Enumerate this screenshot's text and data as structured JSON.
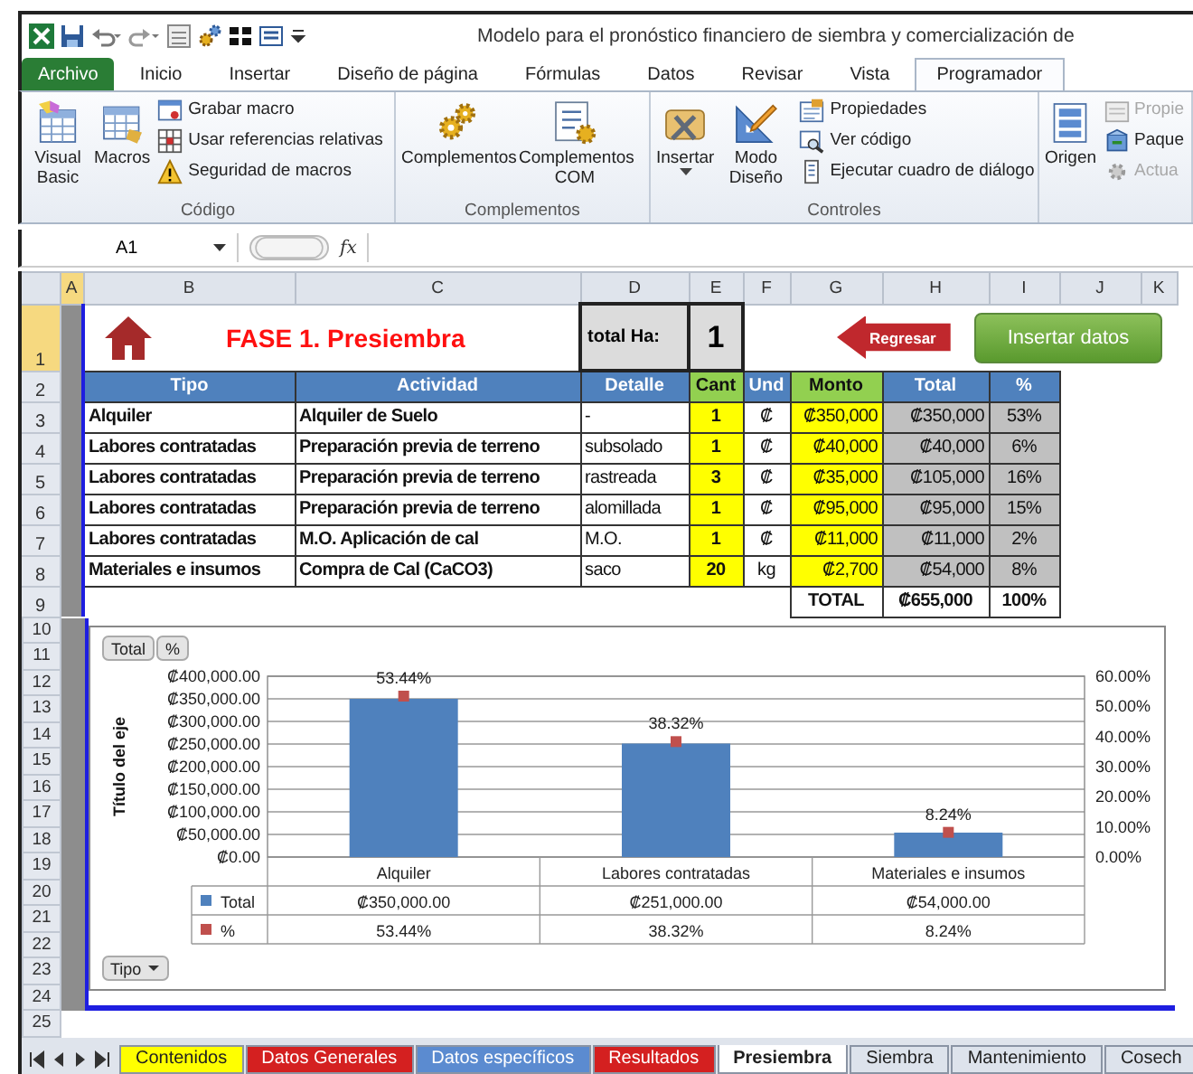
{
  "window": {
    "title": "Modelo para el pronóstico financiero de siembra y comercialización de"
  },
  "menu_tabs": [
    {
      "label": "Archivo",
      "kind": "file",
      "selected": false
    },
    {
      "label": "Inicio",
      "kind": "tab",
      "selected": false
    },
    {
      "label": "Insertar",
      "kind": "tab",
      "selected": false
    },
    {
      "label": "Diseño de página",
      "kind": "tab",
      "selected": false
    },
    {
      "label": "Fórmulas",
      "kind": "tab",
      "selected": false
    },
    {
      "label": "Datos",
      "kind": "tab",
      "selected": false
    },
    {
      "label": "Revisar",
      "kind": "tab",
      "selected": false
    },
    {
      "label": "Vista",
      "kind": "tab",
      "selected": false
    },
    {
      "label": "Programador",
      "kind": "tab",
      "selected": true
    }
  ],
  "ribbon": {
    "groups": [
      {
        "label": "Código",
        "large": [
          {
            "label": "Visual Basic",
            "dropdown": false
          },
          {
            "label": "Macros",
            "dropdown": false
          }
        ],
        "small": [
          {
            "label": "Grabar macro",
            "disabled": false
          },
          {
            "label": "Usar referencias relativas",
            "disabled": false
          },
          {
            "label": "Seguridad de macros",
            "disabled": false
          }
        ]
      },
      {
        "label": "Complementos",
        "large": [
          {
            "label": "Complementos",
            "dropdown": false
          },
          {
            "label": "Complementos COM",
            "dropdown": false
          }
        ]
      },
      {
        "label": "Controles",
        "large": [
          {
            "label": "Insertar",
            "dropdown": true
          },
          {
            "label": "Modo Diseño",
            "dropdown": false
          }
        ],
        "small": [
          {
            "label": "Propiedades",
            "disabled": false
          },
          {
            "label": "Ver código",
            "disabled": false
          },
          {
            "label": "Ejecutar cuadro de diálogo",
            "disabled": false
          }
        ]
      },
      {
        "large": [
          {
            "label": "Origen",
            "dropdown": false
          }
        ],
        "small": [
          {
            "label": "Propie",
            "disabled": true
          },
          {
            "label": "Paque",
            "disabled": false
          },
          {
            "label": "Actua",
            "disabled": true
          }
        ]
      }
    ]
  },
  "formula_bar": {
    "name_box": "A1",
    "function_label": "fx"
  },
  "column_headers": [
    {
      "label": "A",
      "selected": true
    },
    {
      "label": "B",
      "selected": false
    },
    {
      "label": "C",
      "selected": false
    },
    {
      "label": "D",
      "selected": false
    },
    {
      "label": "E",
      "selected": false
    },
    {
      "label": "F",
      "selected": false
    },
    {
      "label": "G",
      "selected": false
    },
    {
      "label": "H",
      "selected": false
    },
    {
      "label": "I",
      "selected": false
    },
    {
      "label": "J",
      "selected": false
    },
    {
      "label": "K",
      "selected": false
    }
  ],
  "row_numbers": [
    {
      "label": "1",
      "selected": true
    },
    {
      "label": "2",
      "selected": false
    },
    {
      "label": "3",
      "selected": false
    },
    {
      "label": "4",
      "selected": false
    },
    {
      "label": "5",
      "selected": false
    },
    {
      "label": "6",
      "selected": false
    },
    {
      "label": "7",
      "selected": false
    },
    {
      "label": "8",
      "selected": false
    },
    {
      "label": "9",
      "selected": false
    },
    {
      "label": "10",
      "selected": false
    },
    {
      "label": "11",
      "selected": false
    },
    {
      "label": "12",
      "selected": false
    },
    {
      "label": "13",
      "selected": false
    },
    {
      "label": "14",
      "selected": false
    },
    {
      "label": "15",
      "selected": false
    },
    {
      "label": "16",
      "selected": false
    },
    {
      "label": "17",
      "selected": false
    },
    {
      "label": "18",
      "selected": false
    },
    {
      "label": "19",
      "selected": false
    },
    {
      "label": "20",
      "selected": false
    },
    {
      "label": "21",
      "selected": false
    },
    {
      "label": "22",
      "selected": false
    },
    {
      "label": "23",
      "selected": false
    },
    {
      "label": "24",
      "selected": false
    },
    {
      "label": "25",
      "selected": false
    }
  ],
  "sheet": {
    "title": "FASE 1. Presiembra",
    "total_ha_label": "total Ha:",
    "total_ha": "1",
    "back_button": "Regresar",
    "insert_button": "Insertar datos",
    "headers": [
      {
        "label": "Tipo",
        "color": "#4f81bd"
      },
      {
        "label": "Actividad",
        "color": "#4f81bd"
      },
      {
        "label": "Detalle",
        "color": "#4f81bd"
      },
      {
        "label": "Cant",
        "color": "#92d050"
      },
      {
        "label": "Und",
        "color": "#4f81bd"
      },
      {
        "label": "Monto",
        "color": "#92d050"
      },
      {
        "label": "Total",
        "color": "#4f81bd"
      },
      {
        "label": "%",
        "color": "#4f81bd"
      }
    ],
    "rows": [
      [
        "Alquiler",
        "Alquiler de Suelo",
        "-",
        "1",
        "₡",
        "₡350,000",
        "₡350,000",
        "53%"
      ],
      [
        "Labores contratadas",
        "Preparación previa de terreno",
        "subsolado",
        "1",
        "₡",
        "₡40,000",
        "₡40,000",
        "6%"
      ],
      [
        "Labores contratadas",
        "Preparación previa de terreno",
        "rastreada",
        "3",
        "₡",
        "₡35,000",
        "₡105,000",
        "16%"
      ],
      [
        "Labores contratadas",
        "Preparación previa de terreno",
        "alomillada",
        "1",
        "₡",
        "₡95,000",
        "₡95,000",
        "15%"
      ],
      [
        "Labores contratadas",
        "M.O. Aplicación de cal",
        "M.O.",
        "1",
        "₡",
        "₡11,000",
        "₡11,000",
        "2%"
      ],
      [
        "Materiales e insumos",
        "Compra de Cal (CaCO3)",
        "saco",
        "20",
        "kg",
        "₡2,700",
        "₡54,000",
        "8%"
      ]
    ],
    "total_row": {
      "label": "TOTAL",
      "total": "₡655,000",
      "percent": "100%"
    }
  },
  "chart": {
    "pivot_buttons": [
      {
        "label": "Total"
      },
      {
        "label": "%"
      }
    ],
    "axis_field_button": "Tipo",
    "chart_data": {
      "type": "bar",
      "ylabel": "Título del eje",
      "categories": [
        "Alquiler",
        "Labores contratadas",
        "Materiales e insumos"
      ],
      "series": [
        {
          "name": "Total",
          "color": "#4f81bd",
          "values": [
            350000,
            251000,
            54000
          ]
        },
        {
          "name": "%",
          "color": "#c0504d",
          "values": [
            53.4,
            38.3,
            8.2
          ]
        }
      ],
      "grid": true,
      "ylim": [
        0,
        400000
      ],
      "yticks": [
        {
          "value": 0,
          "label": "₡0.00"
        },
        {
          "value": 50000,
          "label": "₡50,000.00"
        },
        {
          "value": 100000,
          "label": "₡100,000.00"
        },
        {
          "value": 150000,
          "label": "₡150,000.00"
        },
        {
          "value": 200000,
          "label": "₡200,000.00"
        },
        {
          "value": 250000,
          "label": "₡250,000.00"
        },
        {
          "value": 300000,
          "label": "₡300,000.00"
        },
        {
          "value": 350000,
          "label": "₡350,000.00"
        },
        {
          "value": 400000,
          "label": "₡400,000.00"
        }
      ],
      "value_labels": [
        "53.44%",
        "38.32%",
        "8.24%"
      ]
    },
    "secondary_axis": {
      "ticks": [
        "60.00%",
        "50.00%",
        "40.00%",
        "30.00%",
        "20.00%",
        "10.00%",
        "0.00%"
      ]
    },
    "data_table": [
      {
        "cells": [
          "₡350,000.00",
          "₡251,000.00",
          "₡54,000.00"
        ]
      },
      {
        "cells": [
          "53.44%",
          "38.32%",
          "8.24%"
        ]
      }
    ]
  },
  "sheet_tabs": [
    {
      "label": "Contenidos",
      "color": "#ffff00",
      "selected": false
    },
    {
      "label": "Datos Generales",
      "color": "#d42020",
      "selected": false
    },
    {
      "label": "Datos específicos",
      "color": "#5b8bd0",
      "selected": false
    },
    {
      "label": "Resultados",
      "color": "#d42020",
      "selected": false
    },
    {
      "label": "Presiembra",
      "color": "#ffffff",
      "selected": true
    },
    {
      "label": "Siembra",
      "color": "#dde3ec",
      "selected": false
    },
    {
      "label": "Mantenimiento",
      "color": "#dde3ec",
      "selected": false
    },
    {
      "label": "Cosech",
      "color": "#dde3ec",
      "selected": false
    }
  ]
}
